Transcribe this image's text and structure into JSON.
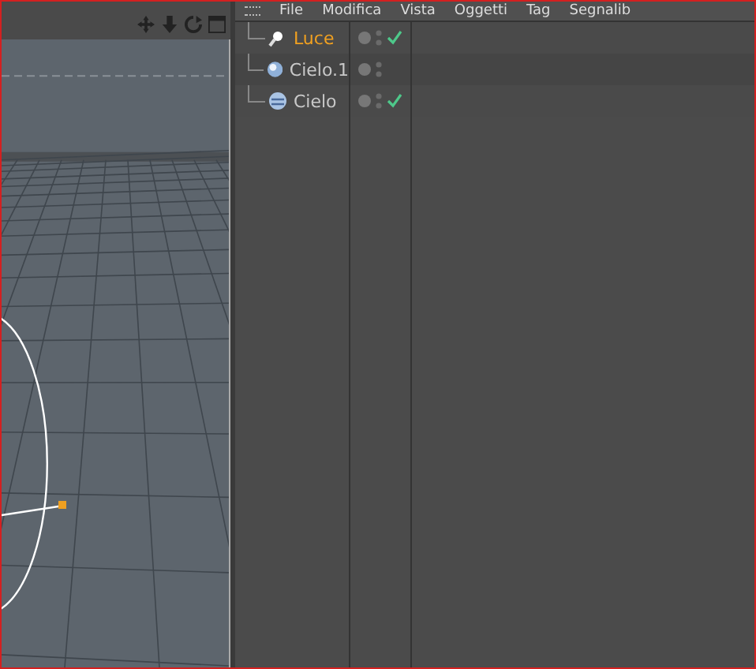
{
  "menu": [
    "File",
    "Modifica",
    "Vista",
    "Oggetti",
    "Tag",
    "Segnalib"
  ],
  "objects": [
    {
      "name": "Luce",
      "kind": "light",
      "selected": true,
      "checked": true
    },
    {
      "name": "Cielo.1",
      "kind": "sphere",
      "selected": false,
      "checked": false
    },
    {
      "name": "Cielo",
      "kind": "sky",
      "selected": false,
      "checked": true
    }
  ]
}
